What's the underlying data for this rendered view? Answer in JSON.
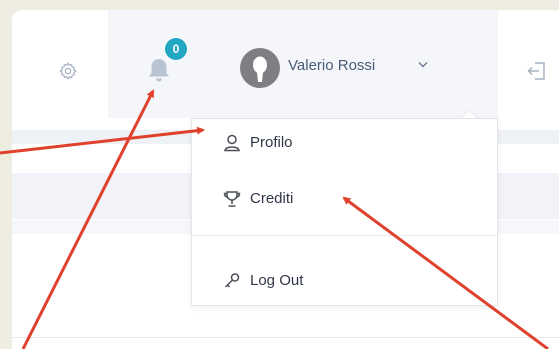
{
  "header": {
    "notifications_count": "0",
    "user_name": "Valerio Rossi"
  },
  "user_menu": {
    "items": [
      {
        "label": "Profilo",
        "icon": "user-icon"
      },
      {
        "label": "Crediti",
        "icon": "trophy-icon"
      },
      {
        "label": "Log Out",
        "icon": "key-icon"
      }
    ]
  },
  "colors": {
    "accent_badge": "#22a7c2",
    "annotation_arrow": "#e0412d",
    "user_name_text": "#4a5b78"
  }
}
